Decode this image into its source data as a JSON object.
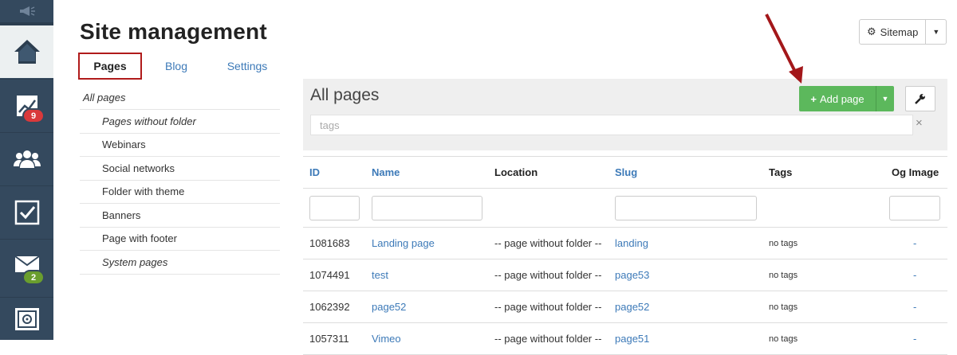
{
  "rail": {
    "items": [
      {
        "name": "megaphone-icon"
      },
      {
        "name": "home-icon"
      },
      {
        "name": "chart-icon",
        "badge": "9"
      },
      {
        "name": "users-icon"
      },
      {
        "name": "tasks-icon"
      },
      {
        "name": "mail-icon",
        "badge": "2"
      },
      {
        "name": "safe-icon"
      }
    ]
  },
  "header": {
    "title": "Site management",
    "sitemap_label": "Sitemap"
  },
  "tabs": [
    {
      "label": "Pages",
      "active": true
    },
    {
      "label": "Blog"
    },
    {
      "label": "Settings"
    }
  ],
  "tree": {
    "root": "All pages",
    "items": [
      "Pages without folder",
      "Webinars",
      "Social networks",
      "Folder with theme",
      "Banners",
      "Page with footer",
      "System pages"
    ]
  },
  "panel": {
    "title": "All pages",
    "add_label": "Add page",
    "tags_placeholder": "tags",
    "clear": "×"
  },
  "table": {
    "columns": [
      "ID",
      "Name",
      "Location",
      "Slug",
      "Tags",
      "Og Image"
    ],
    "rows": [
      {
        "id": "1081683",
        "name": "Landing page",
        "location": "-- page without folder --",
        "slug": "landing",
        "tags": "no tags",
        "og": "-"
      },
      {
        "id": "1074491",
        "name": "test",
        "location": "-- page without folder --",
        "slug": "page53",
        "tags": "no tags",
        "og": "-"
      },
      {
        "id": "1062392",
        "name": "page52",
        "location": "-- page without folder --",
        "slug": "page52",
        "tags": "no tags",
        "og": "-"
      },
      {
        "id": "1057311",
        "name": "Vimeo",
        "location": "-- page without folder --",
        "slug": "page51",
        "tags": "no tags",
        "og": "-"
      }
    ]
  },
  "colors": {
    "rail": "#34495e",
    "accent_green": "#5cb85c",
    "link_blue": "#3d7ab8",
    "highlight_red": "#b01b1b"
  }
}
